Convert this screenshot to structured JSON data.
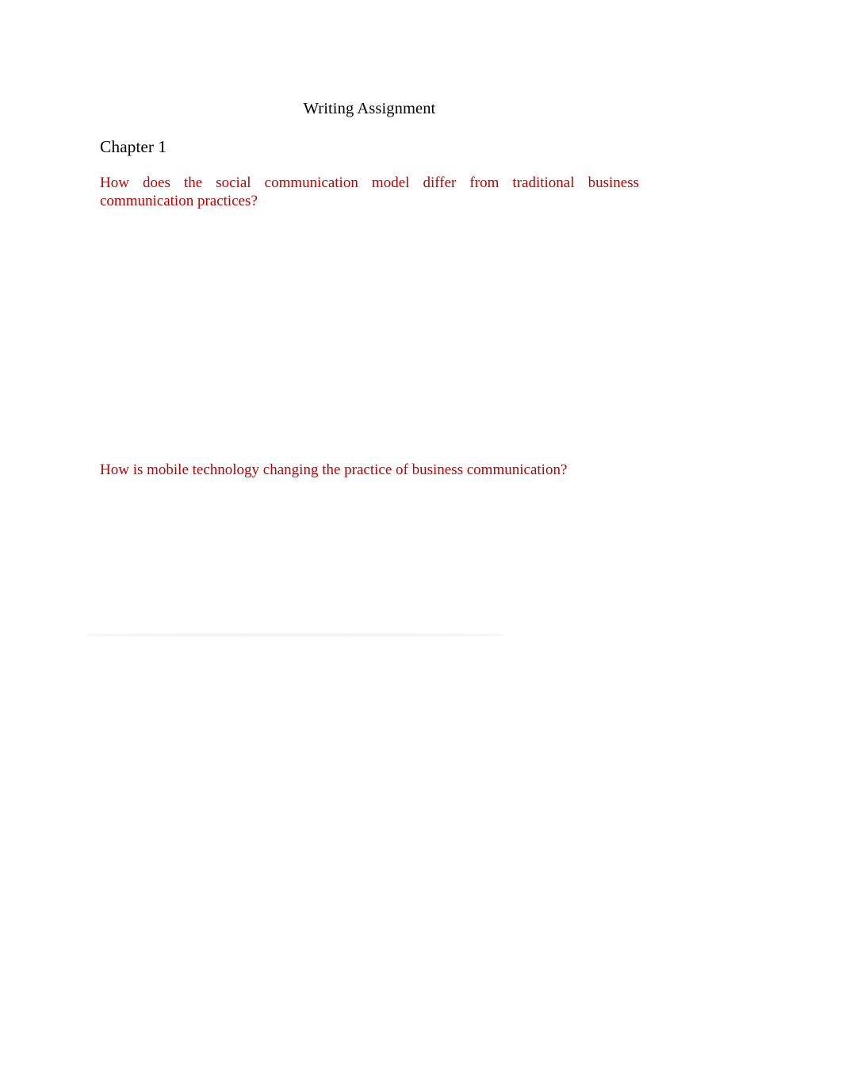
{
  "document": {
    "title": "Writing Assignment",
    "chapter_heading": "Chapter 1",
    "questions": [
      {
        "text": "How does the social communication model differ from traditional business communication practices?",
        "color": "#C00000",
        "align": "justify"
      },
      {
        "text": "How is mobile technology changing the practice of business communication?",
        "color": "#C00000",
        "align": "left"
      }
    ],
    "colors": {
      "page_background": "#FFFFFF",
      "body_text": "#000000",
      "question_text": "#C00000",
      "page_break_line": "#F2F2F4"
    }
  }
}
